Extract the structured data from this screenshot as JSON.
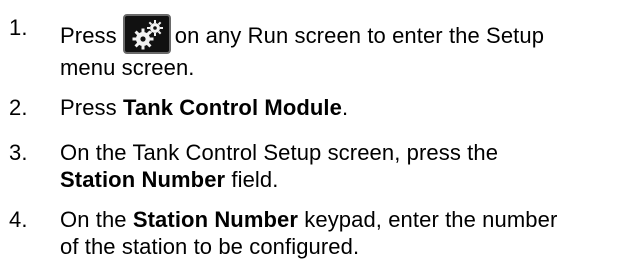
{
  "steps": [
    {
      "number": "1.",
      "text_before": "Press",
      "icon": "setup-gears-icon",
      "text_after": "on any Run screen to enter the Setup",
      "line2": "menu screen."
    },
    {
      "number": "2.",
      "text_before": "Press ",
      "bold": "Tank Control Module",
      "text_after": "."
    },
    {
      "number": "3.",
      "line1": "On the Tank Control Setup screen, press the",
      "bold": "Station Number",
      "text_after": " field."
    },
    {
      "number": "4.",
      "text_before": "On the ",
      "bold": "Station Number",
      "text_after": " keypad, enter the number",
      "line2": "of the station to be configured."
    }
  ],
  "colors": {
    "text": "#000000",
    "button_bg": "#111111",
    "button_border": "#6a6a6a",
    "gear_fill": "#f2f2f2"
  }
}
